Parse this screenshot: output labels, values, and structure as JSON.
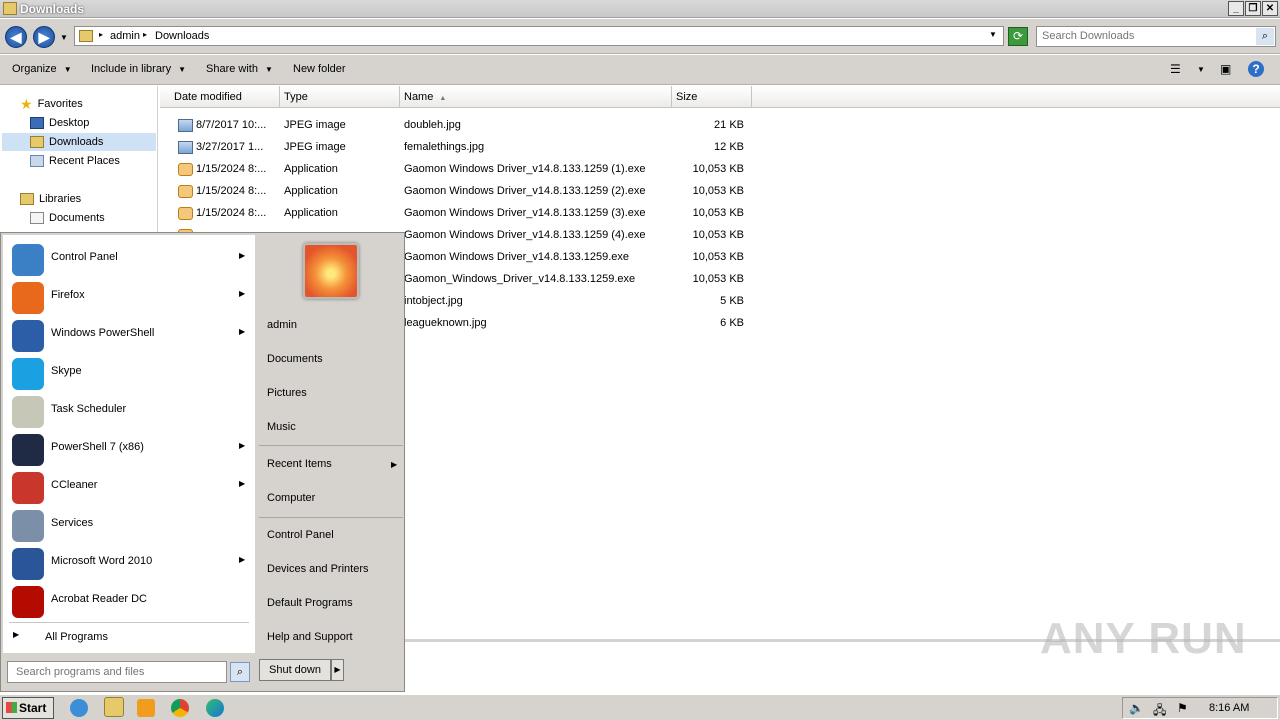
{
  "window": {
    "title": "Downloads"
  },
  "address": {
    "crumbs": [
      "admin",
      "Downloads"
    ]
  },
  "search": {
    "placeholder": "Search Downloads"
  },
  "toolbar": {
    "organize": "Organize",
    "include_in_library": "Include in library",
    "share_with": "Share with",
    "new_folder": "New folder"
  },
  "nav": {
    "favorites": "Favorites",
    "desktop": "Desktop",
    "downloads": "Downloads",
    "recent_places": "Recent Places",
    "libraries": "Libraries",
    "documents": "Documents"
  },
  "columns": {
    "date": "Date modified",
    "type": "Type",
    "name": "Name",
    "size": "Size"
  },
  "files": [
    {
      "date": "8/7/2017 10:...",
      "type": "JPEG image",
      "name": "doubleh.jpg",
      "size": "21 KB",
      "icon": "image-file-icon"
    },
    {
      "date": "3/27/2017 1...",
      "type": "JPEG image",
      "name": "femalethings.jpg",
      "size": "12 KB",
      "icon": "image-file-icon"
    },
    {
      "date": "1/15/2024 8:...",
      "type": "Application",
      "name": "Gaomon Windows Driver_v14.8.133.1259 (1).exe",
      "size": "10,053 KB",
      "icon": "installer-icon"
    },
    {
      "date": "1/15/2024 8:...",
      "type": "Application",
      "name": "Gaomon Windows Driver_v14.8.133.1259 (2).exe",
      "size": "10,053 KB",
      "icon": "installer-icon"
    },
    {
      "date": "1/15/2024 8:...",
      "type": "Application",
      "name": "Gaomon Windows Driver_v14.8.133.1259 (3).exe",
      "size": "10,053 KB",
      "icon": "installer-icon"
    },
    {
      "date": "",
      "type": "",
      "name": "Gaomon Windows Driver_v14.8.133.1259 (4).exe",
      "size": "10,053 KB",
      "icon": "installer-icon"
    },
    {
      "date": "",
      "type": "",
      "name": "Gaomon Windows Driver_v14.8.133.1259.exe",
      "size": "10,053 KB",
      "icon": "installer-icon"
    },
    {
      "date": "",
      "type": "",
      "name": "Gaomon_Windows_Driver_v14.8.133.1259.exe",
      "size": "10,053 KB",
      "icon": "installer-icon"
    },
    {
      "date": "",
      "type": "",
      "name": "intobject.jpg",
      "size": "5 KB",
      "icon": "image-file-icon"
    },
    {
      "date": "",
      "type": "",
      "name": "leagueknown.jpg",
      "size": "6 KB",
      "icon": "image-file-icon"
    }
  ],
  "start_menu": {
    "programs": [
      {
        "label": "Control Panel",
        "icon": "control-panel-icon",
        "color": "#3b7fc4",
        "submenu": true
      },
      {
        "label": "Firefox",
        "icon": "firefox-icon",
        "color": "#e8691c",
        "submenu": true
      },
      {
        "label": "Windows PowerShell",
        "icon": "powershell-icon",
        "color": "#2b5ea7",
        "submenu": true
      },
      {
        "label": "Skype",
        "icon": "skype-icon",
        "color": "#1ba1e2",
        "submenu": false
      },
      {
        "label": "Task Scheduler",
        "icon": "clock-icon",
        "color": "#c7c7b8",
        "submenu": false
      },
      {
        "label": "PowerShell 7 (x86)",
        "icon": "powershell7-icon",
        "color": "#1f2a44",
        "submenu": true
      },
      {
        "label": "CCleaner",
        "icon": "ccleaner-icon",
        "color": "#c8362c",
        "submenu": true
      },
      {
        "label": "Services",
        "icon": "gears-icon",
        "color": "#7c8fa8",
        "submenu": false
      },
      {
        "label": "Microsoft Word 2010",
        "icon": "word-icon",
        "color": "#2a5699",
        "submenu": true
      },
      {
        "label": "Acrobat Reader DC",
        "icon": "acrobat-icon",
        "color": "#b30b00",
        "submenu": false
      }
    ],
    "all_programs": "All Programs",
    "search_placeholder": "Search programs and files",
    "right": {
      "user": "admin",
      "documents": "Documents",
      "pictures": "Pictures",
      "music": "Music",
      "recent_items": "Recent Items",
      "computer": "Computer",
      "control_panel": "Control Panel",
      "devices_printers": "Devices and Printers",
      "default_programs": "Default Programs",
      "help_support": "Help and Support"
    },
    "shutdown": "Shut down"
  },
  "taskbar": {
    "start": "Start",
    "clock": "8:16 AM"
  },
  "watermark": "ANY RUN"
}
